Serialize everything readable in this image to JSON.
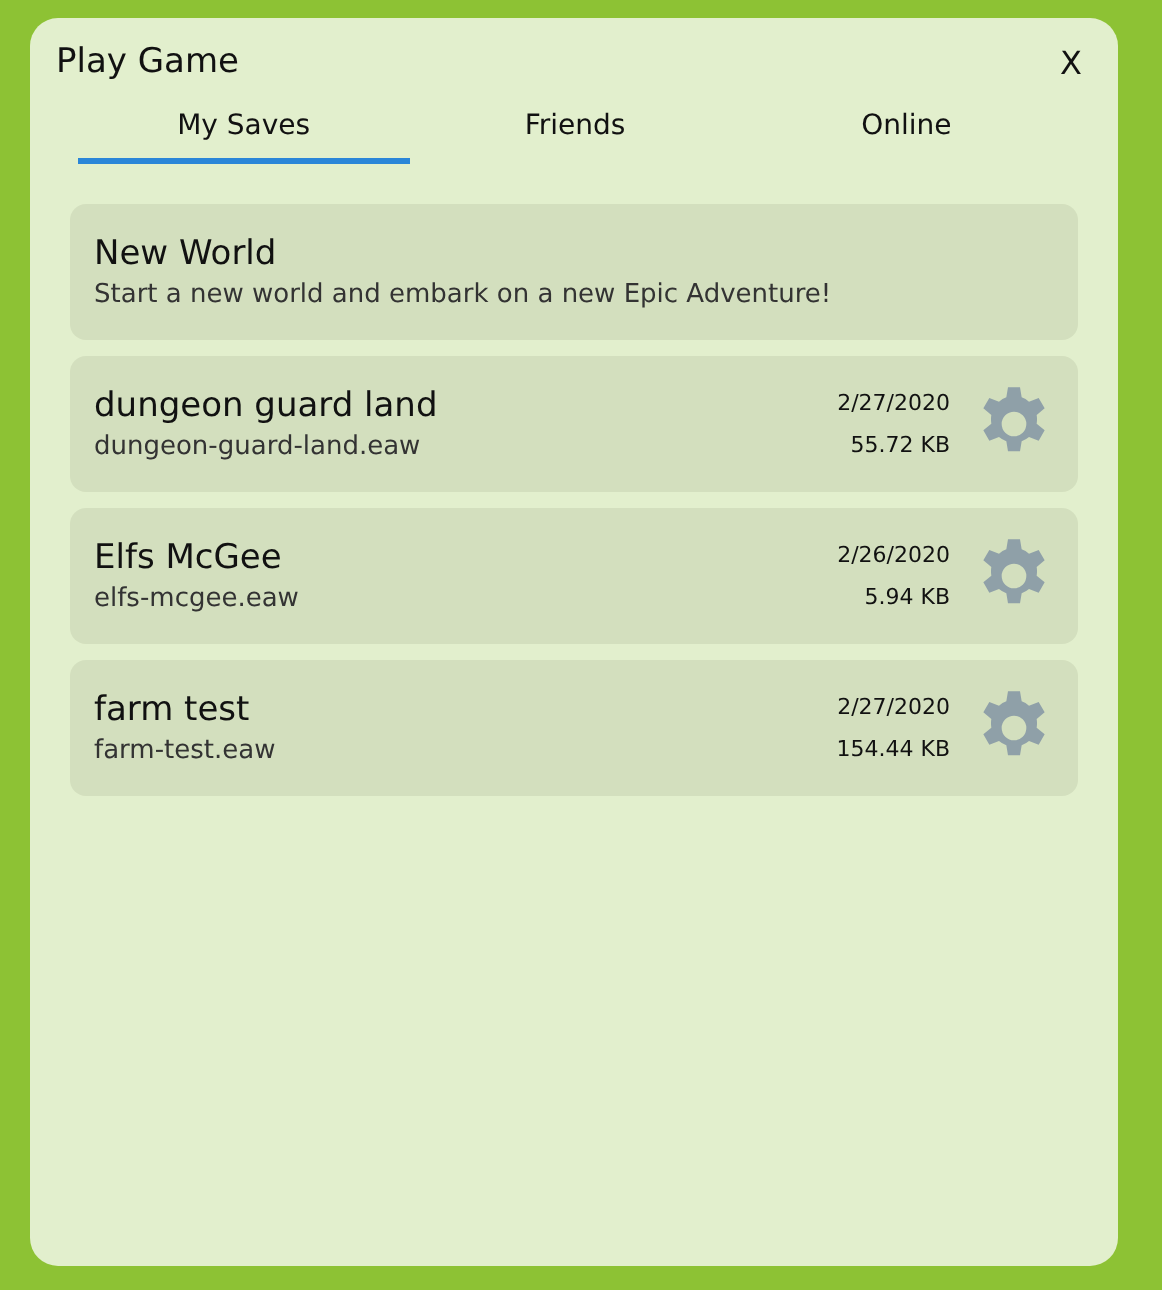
{
  "window": {
    "title": "Play Game",
    "close": "X"
  },
  "tabs": [
    {
      "label": "My Saves",
      "selected": true
    },
    {
      "label": "Friends",
      "selected": false
    },
    {
      "label": "Online",
      "selected": false
    }
  ],
  "saves": [
    {
      "kind": "new",
      "title": "New World",
      "subtitle": "Start a new world and embark on a new Epic Adventure!"
    },
    {
      "kind": "save",
      "title": "dungeon guard land",
      "subtitle": "dungeon-guard-land.eaw",
      "date": "2/27/2020",
      "size": "55.72 KB"
    },
    {
      "kind": "save",
      "title": "Elfs McGee",
      "subtitle": "elfs-mcgee.eaw",
      "date": "2/26/2020",
      "size": "5.94 KB"
    },
    {
      "kind": "save",
      "title": "farm test",
      "subtitle": "farm-test.eaw",
      "date": "2/27/2020",
      "size": "154.44 KB"
    }
  ]
}
